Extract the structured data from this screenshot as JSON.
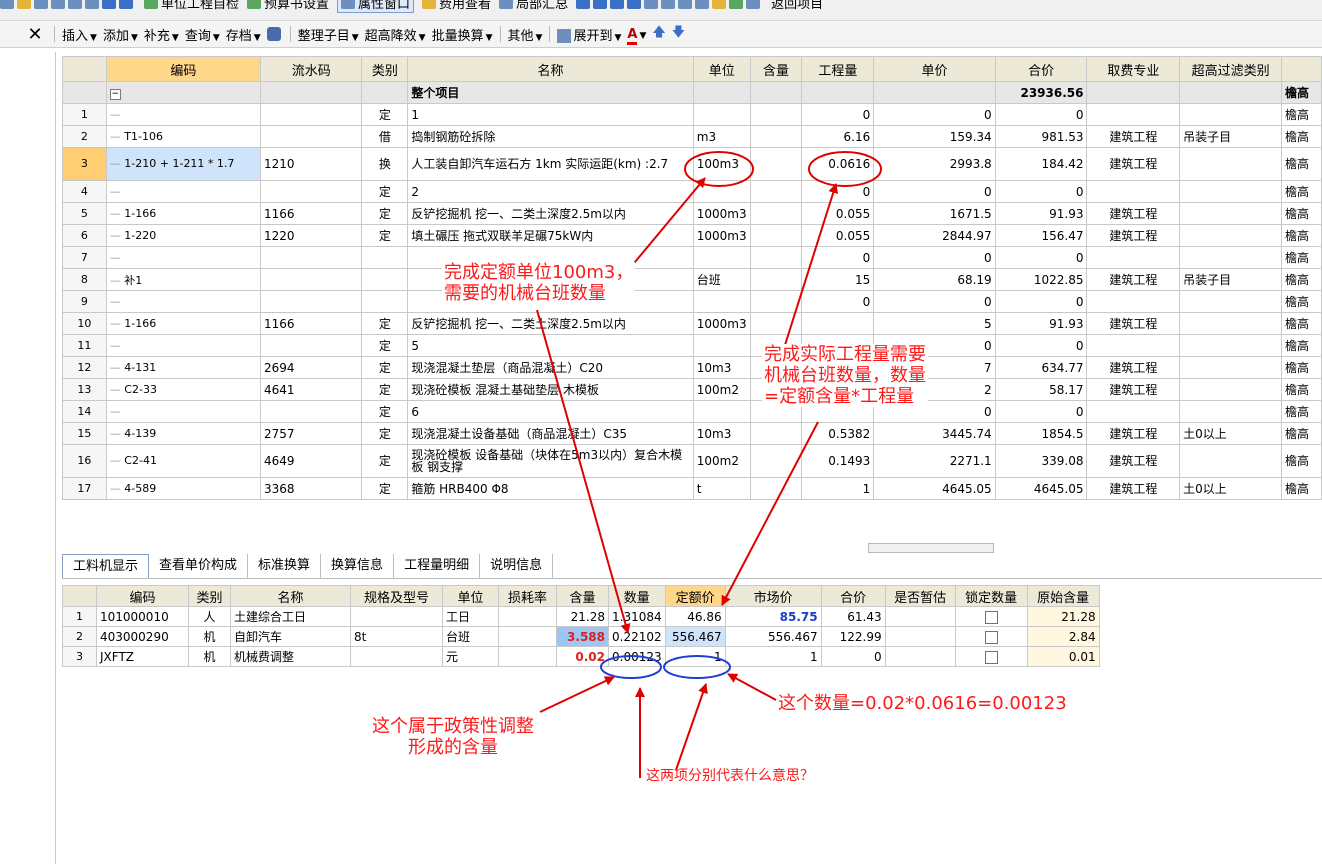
{
  "toolbar1": {
    "items": [
      "单位工程自检",
      "预算书设置",
      "属性窗口",
      "费用查看",
      "局部汇总",
      "返回项目"
    ]
  },
  "toolbar2": {
    "close": "✕",
    "menus": [
      "插入",
      "添加",
      "补充",
      "查询",
      "存档"
    ],
    "organize": "整理子目",
    "overheight": "超高降效",
    "batch": "批量换算",
    "other": "其他",
    "expand": "展开到"
  },
  "grid1": {
    "headers": [
      "",
      "编码",
      "流水码",
      "类别",
      "名称",
      "单位",
      "含量",
      "工程量",
      "单价",
      "合价",
      "取费专业",
      "超高过滤类别",
      ""
    ],
    "root": {
      "name": "整个项目",
      "total": "23936.56",
      "last": "檐高"
    },
    "rows": [
      {
        "n": "1",
        "code": "",
        "flow": "",
        "type": "定",
        "name": "1",
        "unit": "",
        "qty": "0",
        "price": "0",
        "total": "0",
        "fee": "",
        "filter": "",
        "last": "檐高"
      },
      {
        "n": "2",
        "code": "T1-106",
        "flow": "",
        "type": "借",
        "name": "捣制钢筋砼拆除",
        "unit": "m3",
        "qty": "6.16",
        "price": "159.34",
        "total": "981.53",
        "fee": "建筑工程",
        "filter": "吊装子目",
        "last": "檐高"
      },
      {
        "n": "3",
        "code": "1-210 + 1-211 * 1.7",
        "flow": "1210",
        "type": "换",
        "name": "人工装自卸汽车运石方 1km 实际运距(km) :2.7",
        "unit": "100m3",
        "qty": "0.0616",
        "price": "2993.8",
        "total": "184.42",
        "fee": "建筑工程",
        "filter": "",
        "last": "檐高"
      },
      {
        "n": "4",
        "code": "",
        "flow": "",
        "type": "定",
        "name": "2",
        "unit": "",
        "qty": "0",
        "price": "0",
        "total": "0",
        "fee": "",
        "filter": "",
        "last": "檐高"
      },
      {
        "n": "5",
        "code": "1-166",
        "flow": "1166",
        "type": "定",
        "name": "反铲挖掘机 挖一、二类土深度2.5m以内",
        "unit": "1000m3",
        "qty": "0.055",
        "price": "1671.5",
        "total": "91.93",
        "fee": "建筑工程",
        "filter": "",
        "last": "檐高"
      },
      {
        "n": "6",
        "code": "1-220",
        "flow": "1220",
        "type": "定",
        "name": "填土碾压 拖式双联羊足碾75kW内",
        "unit": "1000m3",
        "qty": "0.055",
        "price": "2844.97",
        "total": "156.47",
        "fee": "建筑工程",
        "filter": "",
        "last": "檐高"
      },
      {
        "n": "7",
        "code": "",
        "flow": "",
        "type": "",
        "name": "",
        "unit": "",
        "qty": "0",
        "price": "0",
        "total": "0",
        "fee": "",
        "filter": "",
        "last": "檐高"
      },
      {
        "n": "8",
        "code": "补1",
        "flow": "",
        "type": "",
        "name": "",
        "unit": "台班",
        "qty": "15",
        "price": "68.19",
        "total": "1022.85",
        "fee": "建筑工程",
        "filter": "吊装子目",
        "last": "檐高"
      },
      {
        "n": "9",
        "code": "",
        "flow": "",
        "type": "",
        "name": "",
        "unit": "",
        "qty": "0",
        "price": "0",
        "total": "0",
        "fee": "",
        "filter": "",
        "last": "檐高"
      },
      {
        "n": "10",
        "code": "1-166",
        "flow": "1166",
        "type": "定",
        "name": "反铲挖掘机 挖一、二类土深度2.5m以内",
        "unit": "1000m3",
        "qty": "",
        "price": "5",
        "total": "91.93",
        "fee": "建筑工程",
        "filter": "",
        "last": "檐高"
      },
      {
        "n": "11",
        "code": "",
        "flow": "",
        "type": "定",
        "name": "5",
        "unit": "",
        "qty": "",
        "price": "0",
        "total": "0",
        "fee": "",
        "filter": "",
        "last": "檐高"
      },
      {
        "n": "12",
        "code": "4-131",
        "flow": "2694",
        "type": "定",
        "name": "现浇混凝土垫层（商品混凝土）C20",
        "unit": "10m3",
        "qty": "",
        "price": "7",
        "total": "634.77",
        "fee": "建筑工程",
        "filter": "",
        "last": "檐高"
      },
      {
        "n": "13",
        "code": "C2-33",
        "flow": "4641",
        "type": "定",
        "name": "现浇砼模板 混凝土基础垫层 木模板",
        "unit": "100m2",
        "qty": "",
        "price": "2",
        "total": "58.17",
        "fee": "建筑工程",
        "filter": "",
        "last": "檐高"
      },
      {
        "n": "14",
        "code": "",
        "flow": "",
        "type": "定",
        "name": "6",
        "unit": "",
        "qty": "",
        "price": "0",
        "total": "0",
        "fee": "",
        "filter": "",
        "last": "檐高"
      },
      {
        "n": "15",
        "code": "4-139",
        "flow": "2757",
        "type": "定",
        "name": "现浇混凝土设备基础（商品混凝土）C35",
        "unit": "10m3",
        "qty": "0.5382",
        "price": "3445.74",
        "total": "1854.5",
        "fee": "建筑工程",
        "filter": "土0以上",
        "last": "檐高"
      },
      {
        "n": "16",
        "code": "C2-41",
        "flow": "4649",
        "type": "定",
        "name": "现浇砼模板 设备基础（块体在5m3以内）复合木模板 钢支撑",
        "unit": "100m2",
        "qty": "0.1493",
        "price": "2271.1",
        "total": "339.08",
        "fee": "建筑工程",
        "filter": "",
        "last": "檐高"
      },
      {
        "n": "17",
        "code": "4-589",
        "flow": "3368",
        "type": "定",
        "name": "箍筋 HRB400 Φ8",
        "unit": "t",
        "qty": "1",
        "price": "4645.05",
        "total": "4645.05",
        "fee": "建筑工程",
        "filter": "土0以上",
        "last": "檐高"
      }
    ]
  },
  "tabs": [
    "工料机显示",
    "查看单价构成",
    "标准换算",
    "换算信息",
    "工程量明细",
    "说明信息"
  ],
  "grid2": {
    "headers": [
      "",
      "编码",
      "类别",
      "名称",
      "规格及型号",
      "单位",
      "损耗率",
      "含量",
      "数量",
      "定额价",
      "市场价",
      "合价",
      "是否暂估",
      "锁定数量",
      "原始含量"
    ],
    "rows": [
      {
        "n": "1",
        "code": "101000010",
        "type": "人",
        "name": "土建综合工日",
        "spec": "",
        "unit": "工日",
        "loss": "",
        "content": "21.28",
        "amount": "1.31084",
        "quota": "46.86",
        "market": "85.75",
        "total": "61.43",
        "orig": "21.28"
      },
      {
        "n": "2",
        "code": "403000290",
        "type": "机",
        "name": "自卸汽车",
        "spec": "8t",
        "unit": "台班",
        "loss": "",
        "content": "3.588",
        "amount": "0.22102",
        "quota": "556.467",
        "market": "556.467",
        "total": "122.99",
        "orig": "2.84"
      },
      {
        "n": "3",
        "code": "JXFTZ",
        "type": "机",
        "name": "机械费调整",
        "spec": "",
        "unit": "元",
        "loss": "",
        "content": "0.02",
        "amount": "0.00123",
        "quota": "1",
        "market": "1",
        "total": "0",
        "orig": "0.01"
      }
    ]
  },
  "annotations": {
    "a1_l1": "完成定额单位100m3，",
    "a1_l2": "需要的机械台班数量",
    "a2_l1": "完成实际工程量需要",
    "a2_l2": "机械台班数量，数量",
    "a2_l3": "=定额含量*工程量",
    "a3": "这个数量=0.02*0.0616=0.00123",
    "a4_l1": "这个属于政策性调整",
    "a4_l2": "形成的含量",
    "a5": "这两项分别代表什么意思？"
  },
  "colors": {
    "annotation": "#ff1a1a",
    "circle_red": "#e00000",
    "circle_blue": "#1f3fd0",
    "header": "#ece9d8",
    "header_highlight": "#ffd78a"
  }
}
